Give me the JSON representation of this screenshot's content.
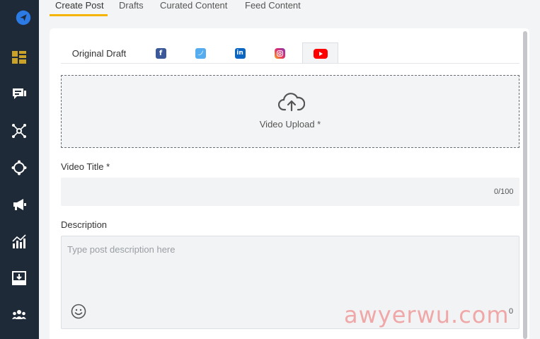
{
  "top_tabs": [
    "Create Post",
    "Drafts",
    "Curated Content",
    "Feed Content"
  ],
  "platform_tabs": {
    "original_label": "Original Draft",
    "platforms": [
      "facebook",
      "twitter",
      "linkedin",
      "instagram",
      "youtube"
    ],
    "active": "youtube"
  },
  "upload": {
    "label": "Video Upload *"
  },
  "video_title": {
    "label": "Video Title *",
    "value": "",
    "counter": "0/100"
  },
  "description": {
    "label": "Description",
    "placeholder": "Type post description here",
    "counter": "0"
  },
  "watermark": "awyerwu.com",
  "colors": {
    "sidebar": "#1e2a38",
    "accent": "#f5b400",
    "field_bg": "#f1f3f4"
  },
  "sidebar_icons": [
    "logo-send-icon",
    "dashboard-icon",
    "chat-icon",
    "network-icon",
    "target-icon",
    "megaphone-icon",
    "analytics-icon",
    "inbox-download-icon",
    "team-icon"
  ]
}
